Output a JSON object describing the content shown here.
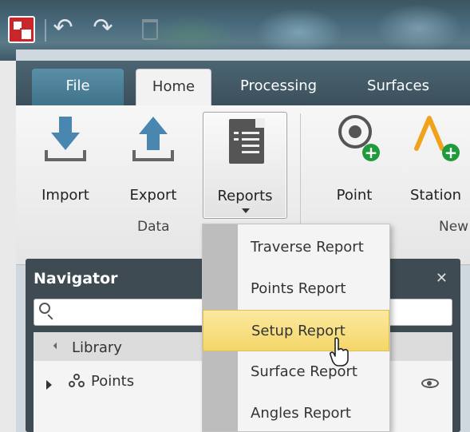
{
  "ribbon_tabs": [
    {
      "label": "File"
    },
    {
      "label": "Home"
    },
    {
      "label": "Processing"
    },
    {
      "label": "Surfaces"
    }
  ],
  "ribbon": {
    "import_label": "Import",
    "export_label": "Export",
    "reports_label": "Reports",
    "point_label": "Point",
    "station_label": "Station",
    "group_data_label": "Data",
    "group_new_label": "New"
  },
  "reports_menu": {
    "items": [
      {
        "label": "Traverse Report"
      },
      {
        "label": "Points Report"
      },
      {
        "label": "Setup Report",
        "highlighted": true
      },
      {
        "label": "Surface Report"
      },
      {
        "label": "Angles Report"
      }
    ]
  },
  "navigator": {
    "title": "Navigator",
    "close_glyph": "✕",
    "search_placeholder": "",
    "library_label": "Library",
    "points_label": "Points"
  },
  "colors": {
    "accent_blue": "#4a87b0",
    "highlight": "#f4d668",
    "add_green": "#1f9b3e"
  }
}
